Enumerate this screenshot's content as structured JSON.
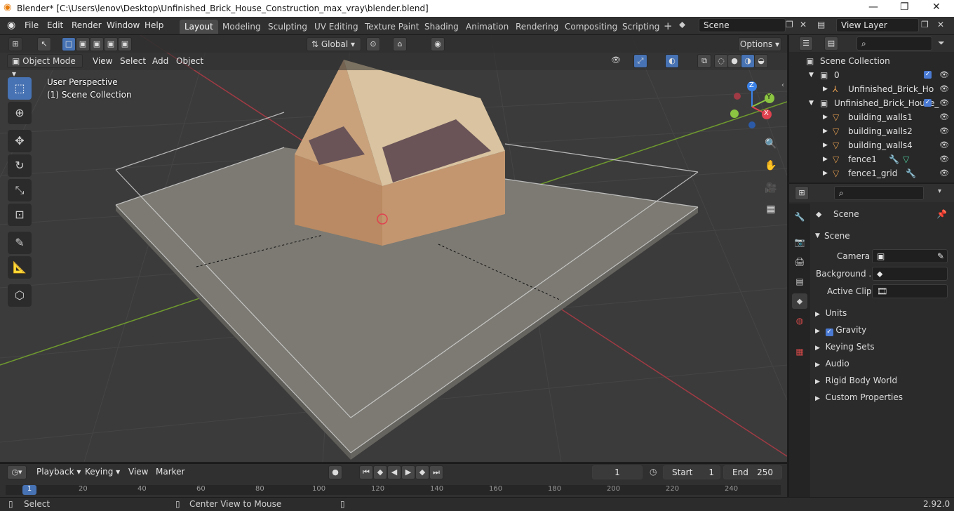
{
  "titlebar": {
    "title": "Blender* [C:\\Users\\lenov\\Desktop\\Unfinished_Brick_House_Construction_max_vray\\blender.blend]"
  },
  "menu": [
    "File",
    "Edit",
    "Render",
    "Window",
    "Help"
  ],
  "workspaces": [
    "Layout",
    "Modeling",
    "Sculpting",
    "UV Editing",
    "Texture Paint",
    "Shading",
    "Animation",
    "Rendering",
    "Compositing",
    "Scripting"
  ],
  "active_workspace": "Layout",
  "scene_field": "Scene",
  "view_layer_field": "View Layer",
  "viewport": {
    "orientation": "Global",
    "options_label": "Options",
    "mode": "Object Mode",
    "menus": [
      "View",
      "Select",
      "Add",
      "Object"
    ],
    "overlay_line1": "User Perspective",
    "overlay_line2": "(1) Scene Collection",
    "gizmo": {
      "z": "Z",
      "y": "Y",
      "x": "X"
    }
  },
  "outliner": {
    "root": "Scene Collection",
    "rows": [
      "0",
      "Unfinished_Brick_Ho",
      "Unfinished_Brick_House_",
      "building_walls1",
      "building_walls2",
      "building_walls4",
      "fence1",
      "fence1_grid"
    ]
  },
  "properties": {
    "context_label": "Scene",
    "panel_title": "Scene",
    "camera_label": "Camera",
    "background_label": "Background ...",
    "active_clip_label": "Active Clip",
    "sections": [
      "Units",
      "Gravity",
      "Keying Sets",
      "Audio",
      "Rigid Body World",
      "Custom Properties"
    ],
    "gravity_checked": true
  },
  "timeline": {
    "menus": [
      "Playback",
      "Keying",
      "View",
      "Marker"
    ],
    "current_frame": "1",
    "start_label": "Start",
    "start_value": "1",
    "end_label": "End",
    "end_value": "250",
    "ruler": [
      "1",
      "20",
      "40",
      "60",
      "80",
      "100",
      "120",
      "140",
      "160",
      "180",
      "200",
      "220",
      "240"
    ]
  },
  "statusbar": {
    "left": "Select",
    "middle": "Center View to Mouse",
    "version": "2.92.0"
  },
  "colors": {
    "accent": "#4772b3",
    "x_axis": "#e0424f",
    "y_axis": "#8bc541",
    "z_axis": "#3b82e8"
  }
}
